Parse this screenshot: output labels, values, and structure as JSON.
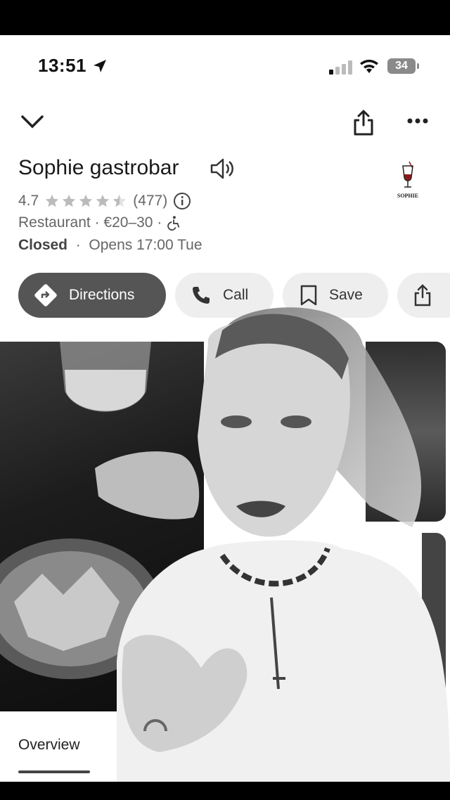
{
  "status_bar": {
    "time": "13:51",
    "battery": "34"
  },
  "place": {
    "name": "Sophie gastrobar",
    "rating": "4.7",
    "rating_stars": 4.5,
    "review_count": "(477)",
    "category": "Restaurant",
    "price": "€20–30",
    "status_closed": "Closed",
    "opens": "Opens 17:00 Tue",
    "logo_text": "SOPHIE"
  },
  "actions": {
    "directions": "Directions",
    "call": "Call",
    "save": "Save"
  },
  "tabs": {
    "overview": "Overview"
  },
  "colors": {
    "chip_primary": "#555555",
    "chip_secondary": "#eeeeee"
  }
}
